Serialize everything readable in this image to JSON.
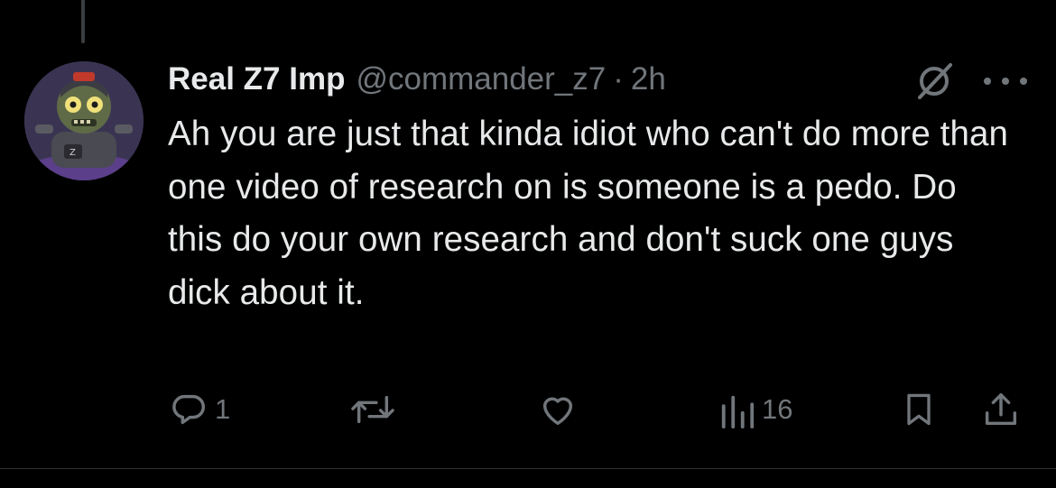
{
  "tweet": {
    "display_name": "Real Z7 Imp",
    "handle": "@commander_z7",
    "separator": "·",
    "time": "2h",
    "text": "Ah you are just that kinda idiot who can't do more than one video of research on is someone is a pedo. Do this do your own research and don't suck one guys dick about it."
  },
  "actions": {
    "reply_count": "1",
    "views_count": "16"
  },
  "icons": {
    "reply": "reply-icon",
    "retweet": "retweet-icon",
    "like": "heart-icon",
    "views": "views-icon",
    "bookmark": "bookmark-icon",
    "share": "share-icon",
    "grok": "grok-icon",
    "more": "more-icon"
  },
  "colors": {
    "background": "#000000",
    "text_primary": "#e7e9ea",
    "text_secondary": "#71767b"
  }
}
